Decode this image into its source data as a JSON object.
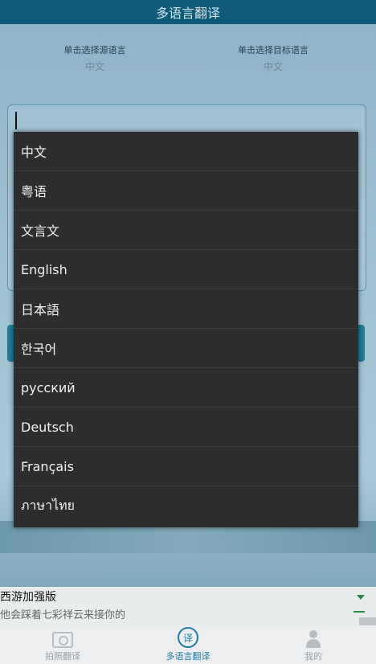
{
  "header": {
    "title": "多语言翻译"
  },
  "language_select": {
    "source_hint": "单击选择源语言",
    "source_value": "中文",
    "target_hint": "单击选择目标语言",
    "target_value": "中文"
  },
  "dropdown": {
    "items": [
      "中文",
      "粤语",
      "文言文",
      "English",
      "日本語",
      "한국어",
      "русский",
      "Deutsch",
      "Français",
      "ภาษาไทย"
    ]
  },
  "ad": {
    "title": "西游加强版",
    "subtitle": "他会踩着七彩祥云来接你的"
  },
  "tabbar": {
    "tabs": [
      {
        "label": "拍照翻译",
        "icon": "camera-icon"
      },
      {
        "label": "多语言翻译",
        "icon": "translate-icon",
        "glyph": "译"
      },
      {
        "label": "我的",
        "icon": "person-icon"
      }
    ],
    "active_index": 1,
    "colors": {
      "active": "#1f7ea3",
      "inactive": "#9aa1a5"
    }
  }
}
